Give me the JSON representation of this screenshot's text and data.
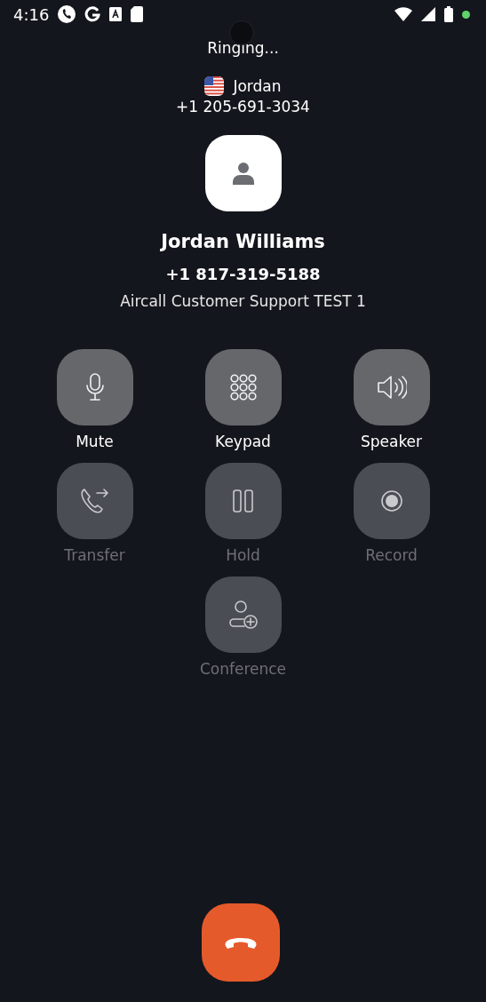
{
  "status_bar": {
    "time": "4:16"
  },
  "call": {
    "status": "Ringing...",
    "line_name": "Jordan",
    "line_number": "+1 205-691-3034",
    "contact_name": "Jordan Williams",
    "contact_number": "+1 817-319-5188",
    "company": "Aircall Customer Support TEST 1"
  },
  "actions": [
    {
      "label": "Mute",
      "kind": "mic",
      "disabled": false
    },
    {
      "label": "Keypad",
      "kind": "keypad",
      "disabled": false
    },
    {
      "label": "Speaker",
      "kind": "speaker",
      "disabled": false
    },
    {
      "label": "Transfer",
      "kind": "transfer",
      "disabled": true
    },
    {
      "label": "Hold",
      "kind": "hold",
      "disabled": true
    },
    {
      "label": "Record",
      "kind": "record",
      "disabled": true
    },
    {
      "label": "Conference",
      "kind": "conference",
      "disabled": true
    }
  ]
}
